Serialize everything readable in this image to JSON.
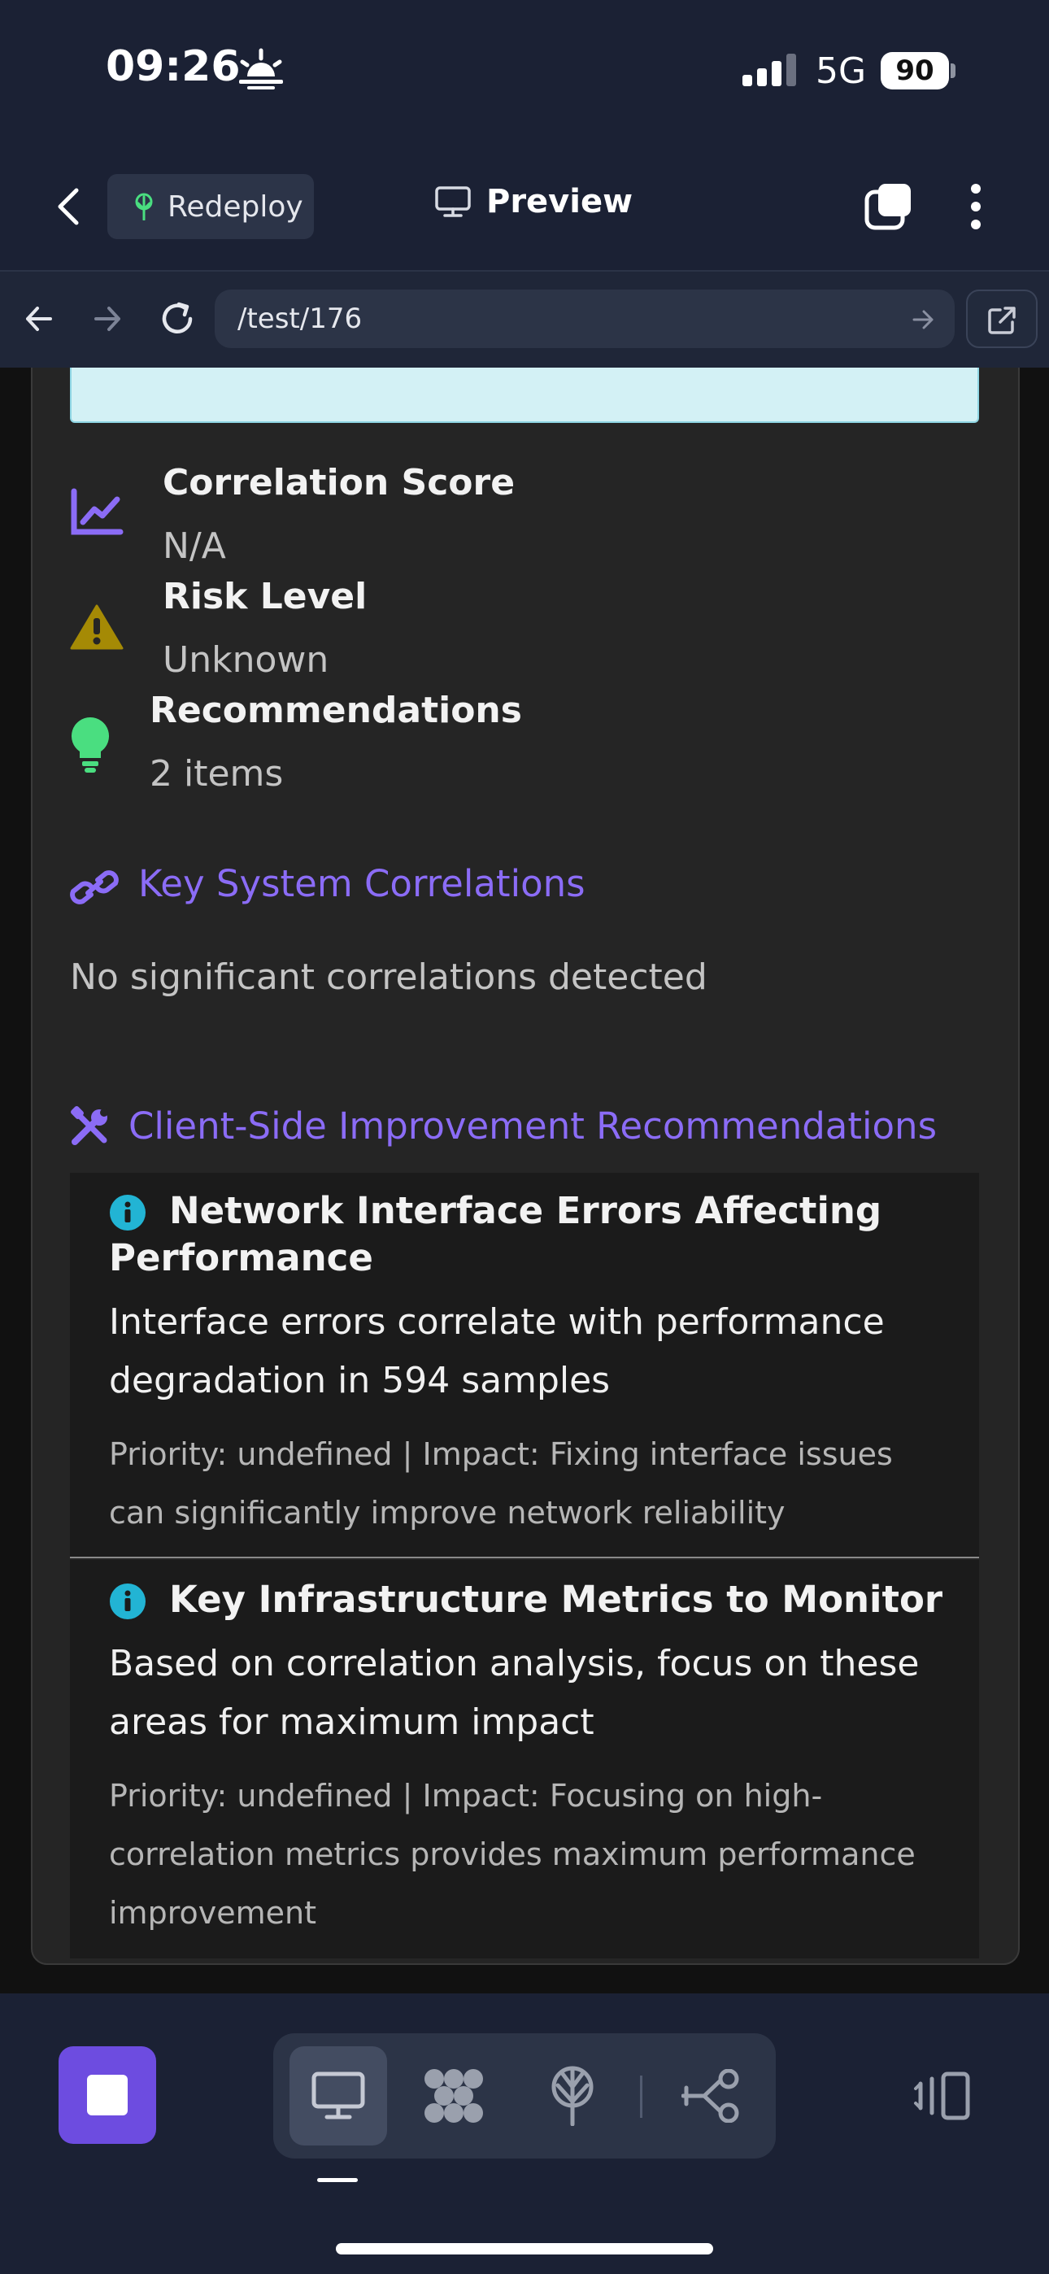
{
  "status_bar": {
    "time": "09:26",
    "network": "5G",
    "battery": "90"
  },
  "header": {
    "back_icon": "chevron-left-icon",
    "redeploy_label": "Redeploy",
    "preview_label": "Preview"
  },
  "browser": {
    "url": "/test/176"
  },
  "content": {
    "stats": [
      {
        "label": "Correlation Score",
        "value": "N/A",
        "icon": "chart-line-icon",
        "color": "#8b6cf6"
      },
      {
        "label": "Risk Level",
        "value": "Unknown",
        "icon": "warning-triangle-icon",
        "color": "#a58a05"
      },
      {
        "label": "Recommendations",
        "value": "2 items",
        "icon": "lightbulb-icon",
        "color": "#4ade80"
      }
    ],
    "correlations": {
      "title": "Key System Correlations",
      "empty_text": "No significant correlations detected"
    },
    "recommendations": {
      "title": "Client-Side Improvement Recommendations",
      "items": [
        {
          "title_line1": "Network Interface Errors Affecting",
          "title_line2": "Performance",
          "desc_line1": "Interface errors correlate with performance",
          "desc_line2": "degradation in 594 samples",
          "meta_line1": "Priority: undefined | Impact: Fixing interface issues",
          "meta_line2": "can significantly improve network reliability"
        },
        {
          "title_line1": "Key Infrastructure Metrics to Monitor",
          "desc_line1": "Based on correlation analysis, focus on these",
          "desc_line2": "areas for maximum impact",
          "meta_line1": "Priority: undefined | Impact: Focusing on high-",
          "meta_line2": "correlation metrics provides maximum performance",
          "meta_line3": "improvement"
        }
      ]
    }
  },
  "colors": {
    "accent": "#8b6cf6",
    "info": "#22b4d4",
    "stop_button": "#6d4ce0",
    "background": "#1b2134"
  }
}
